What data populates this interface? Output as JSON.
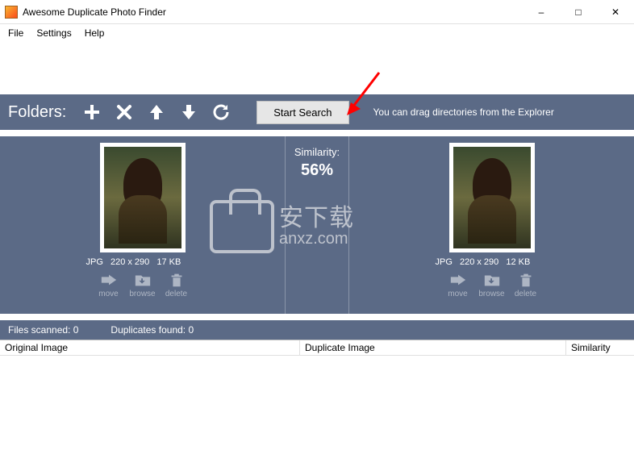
{
  "window": {
    "title": "Awesome Duplicate Photo Finder"
  },
  "menu": {
    "file": "File",
    "settings": "Settings",
    "help": "Help"
  },
  "folders_bar": {
    "label": "Folders:",
    "start_search": "Start Search",
    "drag_hint": "You can drag directories from the Explorer"
  },
  "similarity": {
    "label": "Similarity:",
    "value": "56%"
  },
  "left_image": {
    "format": "JPG",
    "dimensions": "220 x 290",
    "size": "17 KB",
    "actions": {
      "move": "move",
      "browse": "browse",
      "delete": "delete"
    }
  },
  "right_image": {
    "format": "JPG",
    "dimensions": "220 x 290",
    "size": "12 KB",
    "actions": {
      "move": "move",
      "browse": "browse",
      "delete": "delete"
    }
  },
  "status": {
    "scanned_label": "Files scanned:",
    "scanned_value": "0",
    "duplicates_label": "Duplicates found:",
    "duplicates_value": "0"
  },
  "columns": {
    "original": "Original Image",
    "duplicate": "Duplicate Image",
    "similarity": "Similarity"
  },
  "watermark": {
    "cn": "安下载",
    "en": "anxz.com"
  }
}
